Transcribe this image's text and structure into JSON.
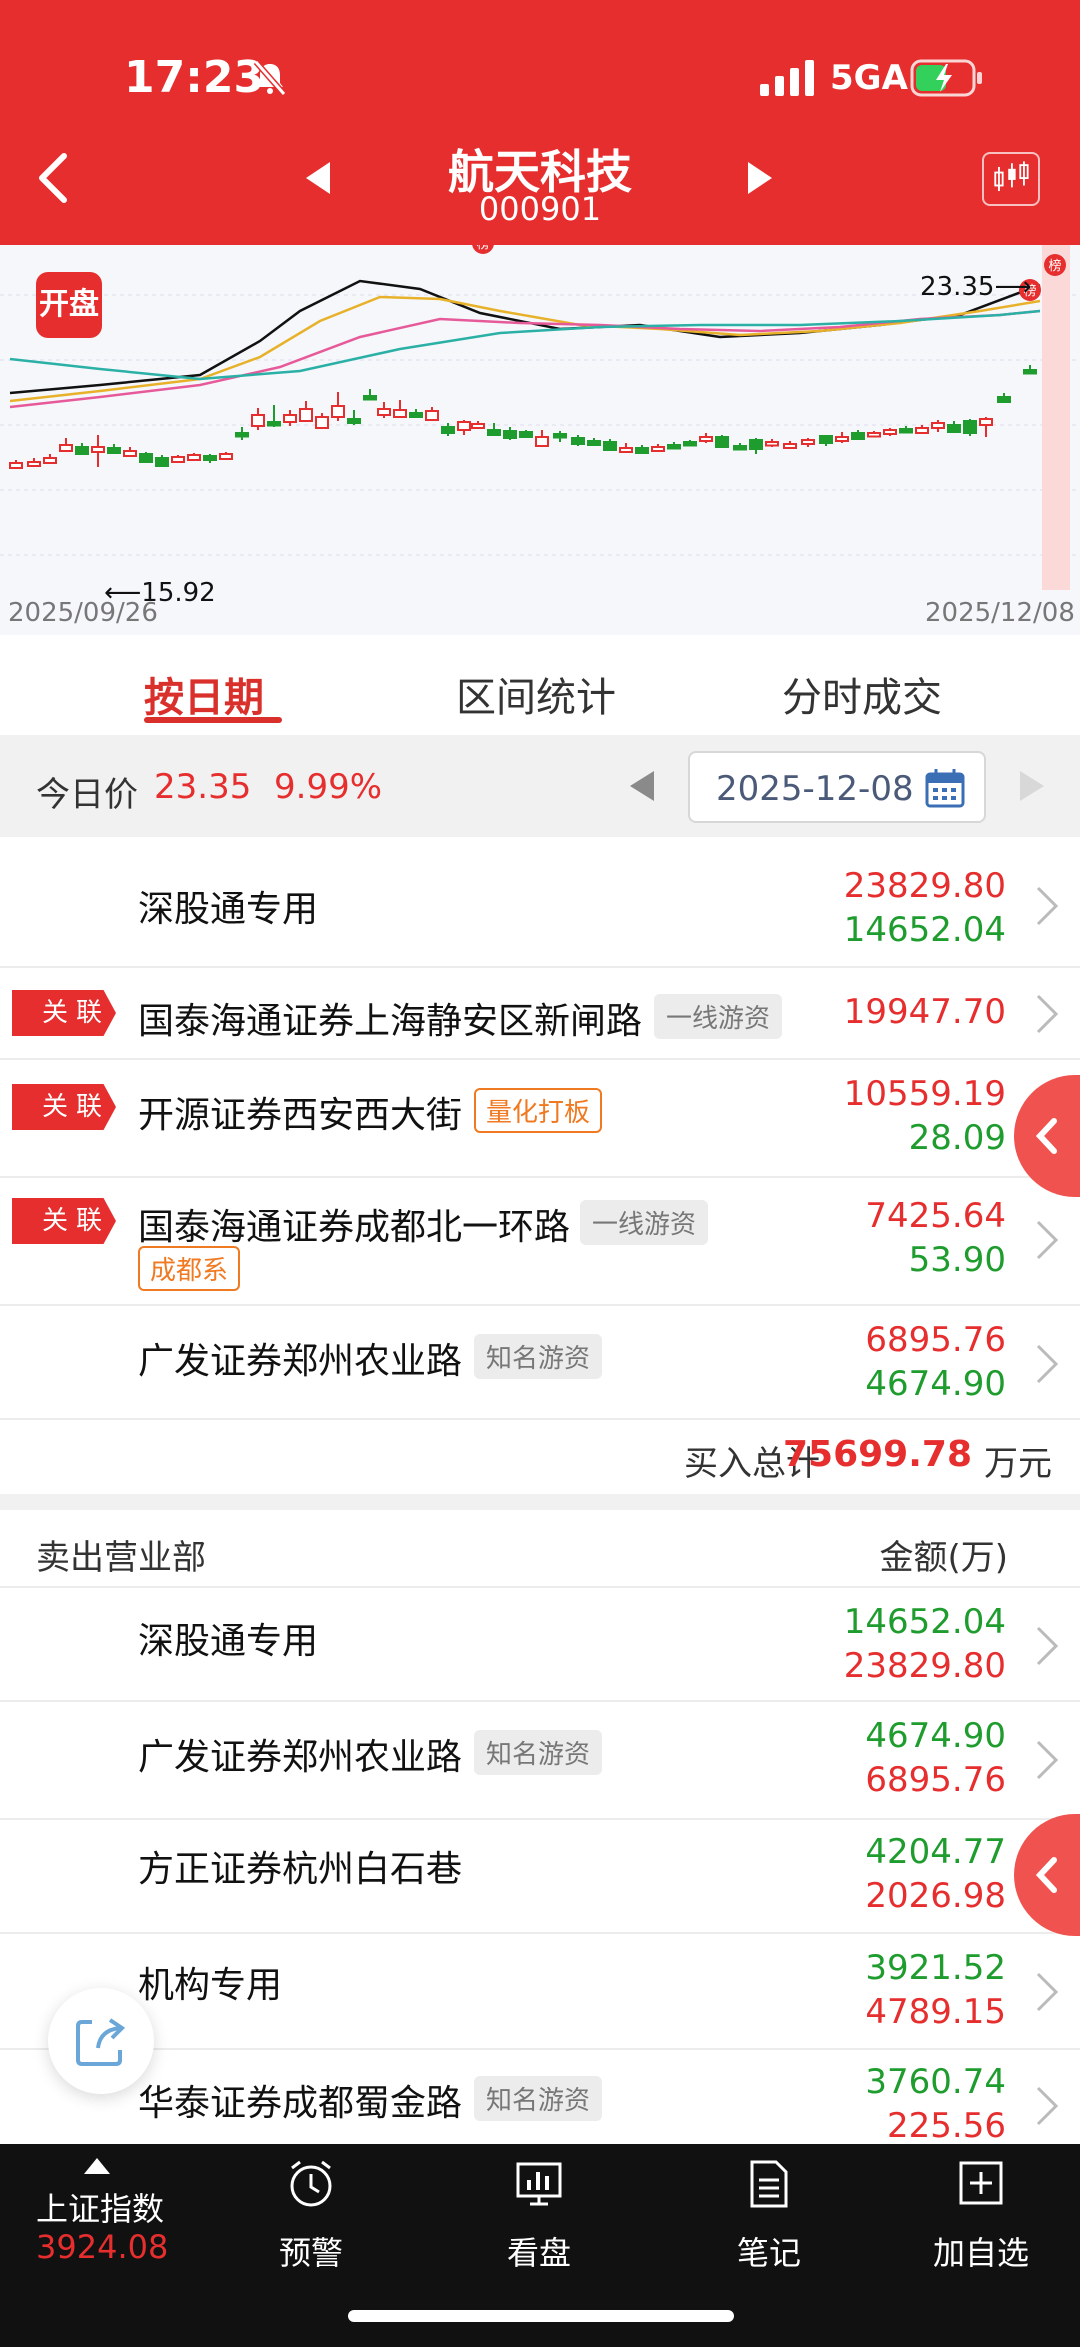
{
  "status_bar": {
    "time": "17:23",
    "network": "5GA"
  },
  "header": {
    "stock_name": "航天科技",
    "stock_code": "000901"
  },
  "chart": {
    "open_badge": "开盘",
    "high_label": "23.35",
    "low_label": "15.92",
    "start_date": "2025/09/26",
    "end_date": "2025/12/08",
    "list_marker": "榜"
  },
  "tabs": [
    "按日期",
    "区间统计",
    "分时成交"
  ],
  "date_bar": {
    "label": "今日价",
    "price": "23.35",
    "change_pct": "9.99%",
    "date": "2025-12-08"
  },
  "buy_rows": [
    {
      "related": false,
      "name": "深股通专用",
      "tags": [],
      "sub_tags": [],
      "buy": "23829.80",
      "sell": "14652.04"
    },
    {
      "related": true,
      "name": "国泰海通证券上海静安区新闸路",
      "tags": [
        "一线游资"
      ],
      "sub_tags": [],
      "buy": "19947.70",
      "sell": ""
    },
    {
      "related": true,
      "name": "开源证券西安西大街",
      "tags": [],
      "orange_tag": "量化打板",
      "buy": "10559.19",
      "sell": "28.09"
    },
    {
      "related": true,
      "name": "国泰海通证券成都北一环路",
      "tags": [
        "一线游资"
      ],
      "orange_tag": "成都系",
      "buy": "7425.64",
      "sell": "53.90"
    },
    {
      "related": false,
      "name": "广发证券郑州农业路",
      "tags": [
        "知名游资"
      ],
      "buy": "6895.76",
      "sell": "4674.90"
    }
  ],
  "related_label": "关联",
  "total": {
    "label": "买入总计",
    "value": "75699.78",
    "unit": "万元"
  },
  "sell_header": {
    "title": "卖出营业部",
    "amount": "金额(万)"
  },
  "sell_rows": [
    {
      "name": "深股通专用",
      "tag": "",
      "sell": "14652.04",
      "buy": "23829.80"
    },
    {
      "name": "广发证券郑州农业路",
      "tag": "知名游资",
      "sell": "4674.90",
      "buy": "6895.76"
    },
    {
      "name": "方正证券杭州白石巷",
      "tag": "",
      "sell": "4204.77",
      "buy": "2026.98"
    },
    {
      "name": "机构专用",
      "tag": "",
      "sell": "3921.52",
      "buy": "4789.15"
    },
    {
      "name": "华泰证券成都蜀金路",
      "tag": "知名游资",
      "sell": "3760.74",
      "buy": "225.56"
    }
  ],
  "bottom_nav": {
    "index_label": "上证指数",
    "index_value": "3924.08",
    "items": [
      "预警",
      "看盘",
      "笔记",
      "加自选"
    ]
  },
  "colors": {
    "brand_red": "#e62e2e",
    "up": "#e62e2e",
    "down": "#1f9c2e"
  }
}
